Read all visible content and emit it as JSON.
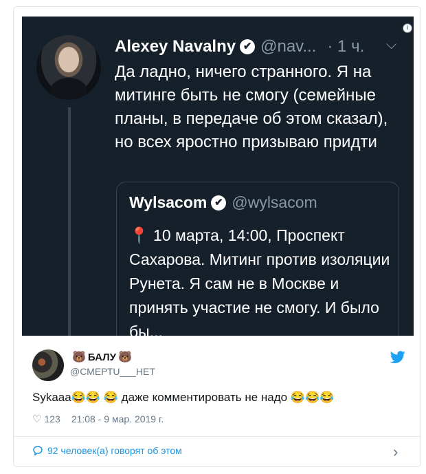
{
  "embedded_tweet": {
    "author_name": "Alexey Navalny",
    "verified_mark": "✔",
    "author_handle": "@nav...",
    "time": "· 1 ч.",
    "chevron": "⌵",
    "text": "Да ладно, ничего странного. Я на митинге быть не смогу (семейные планы, в передаче об этом сказал), но всех яростно призываю придти",
    "quote": {
      "author_name": "Wylsacom",
      "author_handle": "@wylsacom",
      "pin": "📍",
      "text": " 10 марта, 14:00, Проспект Сахарова. Митинг против изоляции Рунета. Я сам не в Москве и принять участие не смогу. И было бы..."
    }
  },
  "reply": {
    "bear_left": "🐻",
    "name": "БАЛУ",
    "bear_right": "🐻",
    "handle": "@СМЕРТU___НЕТ",
    "text": "Sykaaa😂😂 😂 даже комментировать не надо 😂😂😂",
    "likes": "123",
    "timestamp": "21:08 - 9 мар. 2019 г."
  },
  "footer": {
    "talk_label": "92 человек(а) говорят об этом",
    "chevron": "›"
  },
  "icons": {
    "info": "i",
    "heart": "♡",
    "talk": "💬"
  },
  "colors": {
    "dark_bg": "#15202b",
    "twitter_blue": "#1da1f2",
    "link_blue": "#1b95e0"
  }
}
